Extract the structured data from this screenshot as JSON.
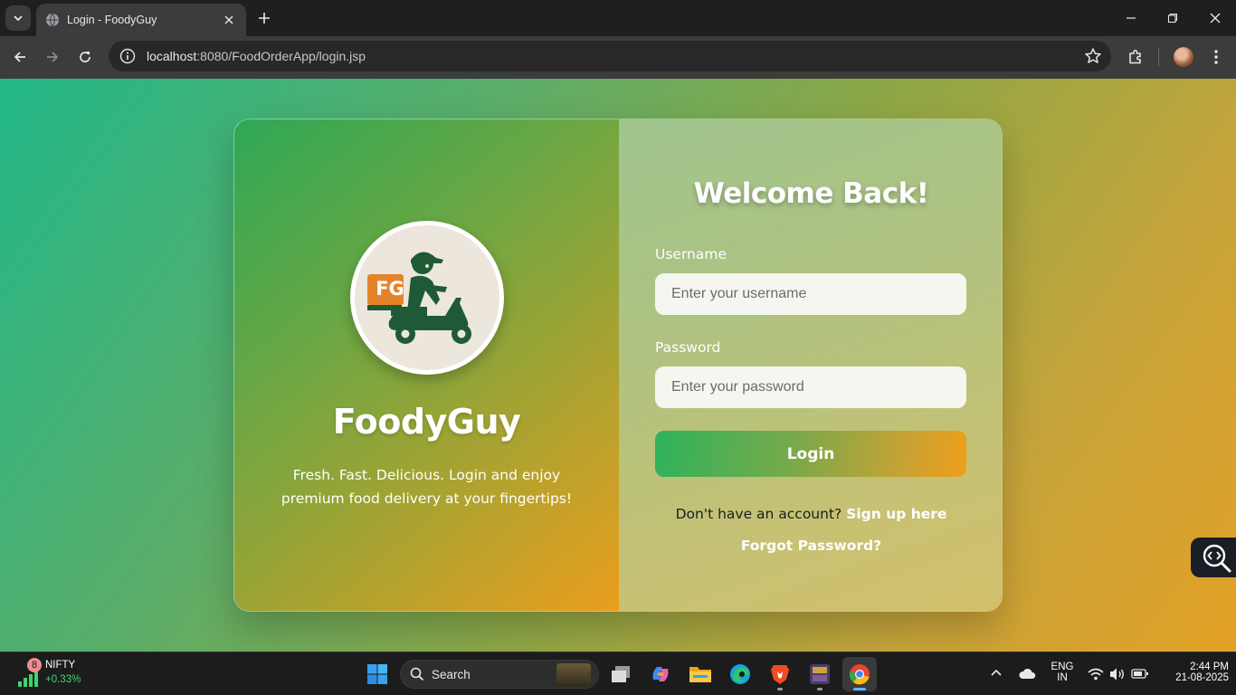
{
  "browser": {
    "tab_title": "Login - FoodyGuy",
    "url_host": "localhost",
    "url_path": ":8080/FoodOrderApp/login.jsp"
  },
  "page": {
    "brand": {
      "name": "FoodyGuy",
      "tagline_line1": "Fresh. Fast. Delicious. Login and enjoy",
      "tagline_line2": "premium food delivery at your fingertips!",
      "logo_text": "FG"
    },
    "form": {
      "heading": "Welcome Back!",
      "username_label": "Username",
      "username_placeholder": "Enter your username",
      "password_label": "Password",
      "password_placeholder": "Enter your password",
      "login_label": "Login",
      "signup_prompt": "Don't have an account?",
      "signup_link": "Sign up here",
      "forgot_link": "Forgot Password?"
    }
  },
  "taskbar": {
    "widget": {
      "badge": "8",
      "name": "NIFTY",
      "value": "+0.33%"
    },
    "search_label": "Search",
    "apps": [
      "windows-start",
      "task-view",
      "copilot",
      "file-explorer",
      "edge",
      "brave",
      "game-app",
      "chrome"
    ],
    "tray": {
      "lang_top": "ENG",
      "lang_bottom": "IN",
      "time": "2:44 PM",
      "date": "21-08-2025"
    }
  }
}
